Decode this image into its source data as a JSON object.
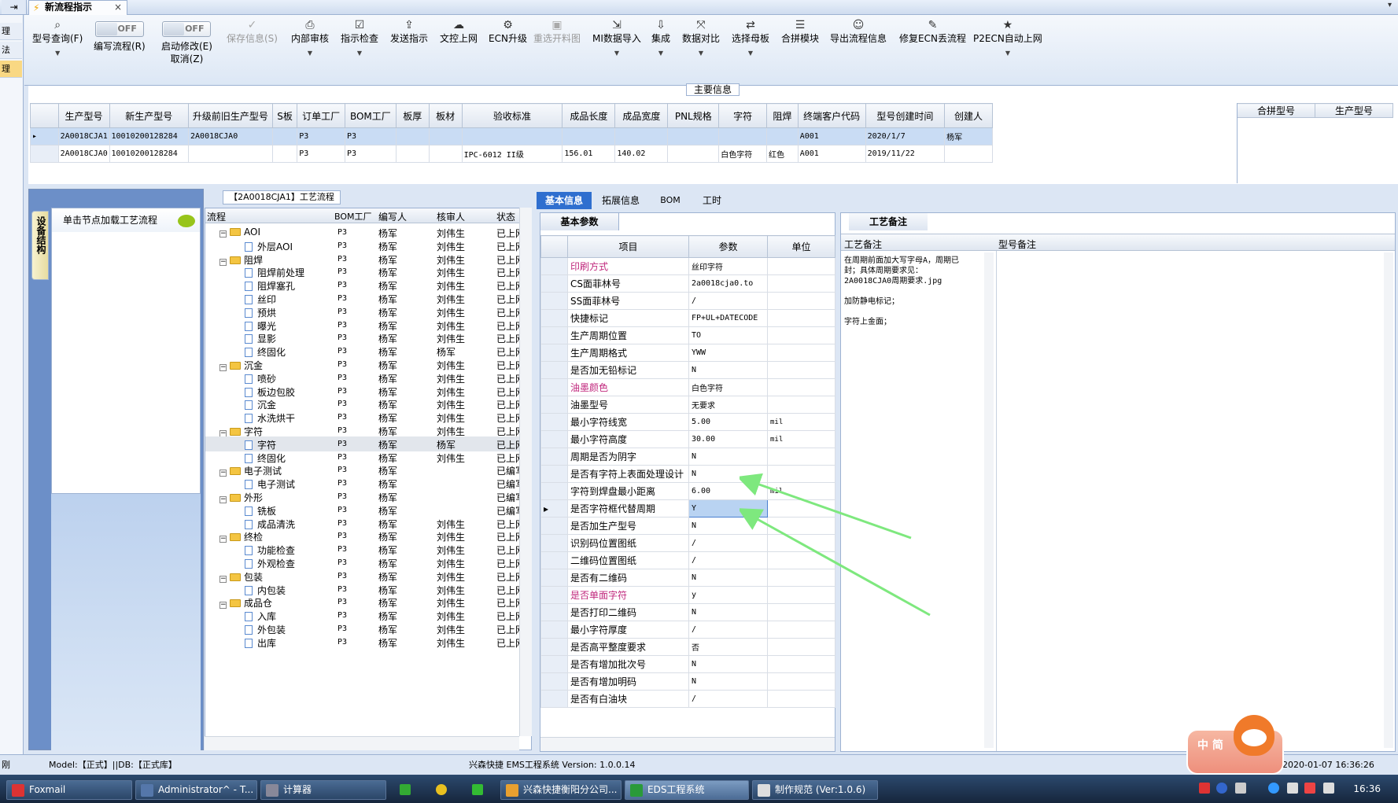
{
  "window": {
    "tab_title": "新流程指示",
    "close": "×"
  },
  "left_dock": {
    "items": [
      "理",
      "法",
      "理"
    ]
  },
  "ribbon": {
    "buttons": [
      {
        "label": "型号查询(F)",
        "icon": "search-icon",
        "has_dropdown": true
      },
      {
        "label": "编写流程(R)",
        "toggle": "OFF"
      },
      {
        "label": "启动修改(E)",
        "label2": "取消(Z)",
        "toggle": "OFF"
      },
      {
        "label": "保存信息(S)",
        "icon": "check-icon",
        "disabled": true
      },
      {
        "label": "内部审核",
        "icon": "print-icon",
        "has_dropdown": true
      },
      {
        "label": "指示检查",
        "icon": "checklist-icon",
        "has_dropdown": true
      },
      {
        "label": "发送指示",
        "icon": "upload-icon"
      },
      {
        "label": "文控上网",
        "icon": "cloud-upload-icon"
      },
      {
        "label": "ECN升级",
        "icon": "ecn-icon"
      },
      {
        "label": "重选开料图",
        "icon": "image-icon",
        "disabled": true
      },
      {
        "label": "MI数据导入",
        "icon": "import-icon",
        "has_dropdown": true
      },
      {
        "label": "集成",
        "icon": "download-icon",
        "has_dropdown": true
      },
      {
        "label": "数据对比",
        "icon": "compare-icon",
        "has_dropdown": true
      },
      {
        "label": "选择母板",
        "icon": "shuffle-icon",
        "has_dropdown": true
      },
      {
        "label": "合拼模块",
        "icon": "list-icon"
      },
      {
        "label": "导出流程信息",
        "icon": "smile-icon"
      },
      {
        "label": "修复ECN丢流程",
        "icon": "wrench-icon"
      },
      {
        "label": "P2ECN自动上网",
        "icon": "star-icon",
        "has_dropdown": true
      }
    ]
  },
  "main_info": {
    "legend": "主要信息",
    "columns": [
      "生产型号",
      "新生产型号",
      "升级前旧生产型号",
      "S板",
      "订单工厂",
      "BOM工厂",
      "板厚",
      "板材",
      "验收标准",
      "成品长度",
      "成品宽度",
      "PNL规格",
      "字符",
      "阻焊",
      "终端客户代码",
      "型号创建时间",
      "创建人"
    ],
    "rows": [
      [
        "2A0018CJA1",
        "10010200128284",
        "2A0018CJA0",
        "",
        "P3",
        "P3",
        "",
        "",
        "",
        "",
        "",
        "",
        "",
        "",
        "A001",
        "2020/1/7",
        "杨军"
      ],
      [
        "2A0018CJA0",
        "10010200128284",
        "",
        "",
        "P3",
        "P3",
        "",
        "",
        "IPC-6012 II级",
        "156.01",
        "140.02",
        "",
        "白色字符",
        "红色",
        "A001",
        "2019/11/22",
        ""
      ]
    ],
    "side_columns": [
      "合拼型号",
      "生产型号"
    ]
  },
  "left_panel": {
    "vertical_tab": "设备结构",
    "header": "单击节点加载工艺流程"
  },
  "flow": {
    "legend": "【2A0018CJA1】工艺流程",
    "columns": [
      "流程",
      "BOM工厂",
      "编写人",
      "核审人",
      "状态"
    ],
    "rows": [
      {
        "level": 1,
        "folder": true,
        "name": "AOI",
        "bom": "P3",
        "writer": "杨军",
        "reviewer": "刘伟生",
        "status": "已上网"
      },
      {
        "level": 2,
        "folder": false,
        "name": "外层AOI",
        "bom": "P3",
        "writer": "杨军",
        "reviewer": "刘伟生",
        "status": "已上网"
      },
      {
        "level": 1,
        "folder": true,
        "name": "阻焊",
        "bom": "P3",
        "writer": "杨军",
        "reviewer": "刘伟生",
        "status": "已上网"
      },
      {
        "level": 2,
        "folder": false,
        "name": "阻焊前处理",
        "bom": "P3",
        "writer": "杨军",
        "reviewer": "刘伟生",
        "status": "已上网"
      },
      {
        "level": 2,
        "folder": false,
        "name": "阻焊塞孔",
        "bom": "P3",
        "writer": "杨军",
        "reviewer": "刘伟生",
        "status": "已上网"
      },
      {
        "level": 2,
        "folder": false,
        "name": "丝印",
        "bom": "P3",
        "writer": "杨军",
        "reviewer": "刘伟生",
        "status": "已上网"
      },
      {
        "level": 2,
        "folder": false,
        "name": "预烘",
        "bom": "P3",
        "writer": "杨军",
        "reviewer": "刘伟生",
        "status": "已上网"
      },
      {
        "level": 2,
        "folder": false,
        "name": "曝光",
        "bom": "P3",
        "writer": "杨军",
        "reviewer": "刘伟生",
        "status": "已上网"
      },
      {
        "level": 2,
        "folder": false,
        "name": "显影",
        "bom": "P3",
        "writer": "杨军",
        "reviewer": "刘伟生",
        "status": "已上网"
      },
      {
        "level": 2,
        "folder": false,
        "name": "终固化",
        "bom": "P3",
        "writer": "杨军",
        "reviewer": "杨军",
        "status": "已上网"
      },
      {
        "level": 1,
        "folder": true,
        "name": "沉金",
        "bom": "P3",
        "writer": "杨军",
        "reviewer": "刘伟生",
        "status": "已上网"
      },
      {
        "level": 2,
        "folder": false,
        "name": "喷砂",
        "bom": "P3",
        "writer": "杨军",
        "reviewer": "刘伟生",
        "status": "已上网"
      },
      {
        "level": 2,
        "folder": false,
        "name": "板边包胶",
        "bom": "P3",
        "writer": "杨军",
        "reviewer": "刘伟生",
        "status": "已上网"
      },
      {
        "level": 2,
        "folder": false,
        "name": "沉金",
        "bom": "P3",
        "writer": "杨军",
        "reviewer": "刘伟生",
        "status": "已上网"
      },
      {
        "level": 2,
        "folder": false,
        "name": "水洗烘干",
        "bom": "P3",
        "writer": "杨军",
        "reviewer": "刘伟生",
        "status": "已上网"
      },
      {
        "level": 1,
        "folder": true,
        "name": "字符",
        "bom": "P3",
        "writer": "杨军",
        "reviewer": "刘伟生",
        "status": "已上网"
      },
      {
        "level": 2,
        "folder": false,
        "name": "字符",
        "bom": "P3",
        "writer": "杨军",
        "reviewer": "杨军",
        "status": "已上网",
        "highlight": true
      },
      {
        "level": 2,
        "folder": false,
        "name": "终固化",
        "bom": "P3",
        "writer": "杨军",
        "reviewer": "刘伟生",
        "status": "已上网"
      },
      {
        "level": 1,
        "folder": true,
        "name": "电子测试",
        "bom": "P3",
        "writer": "杨军",
        "reviewer": "",
        "status": "已编写"
      },
      {
        "level": 2,
        "folder": false,
        "name": "电子测试",
        "bom": "P3",
        "writer": "杨军",
        "reviewer": "",
        "status": "已编写"
      },
      {
        "level": 1,
        "folder": true,
        "name": "外形",
        "bom": "P3",
        "writer": "杨军",
        "reviewer": "",
        "status": "已编写"
      },
      {
        "level": 2,
        "folder": false,
        "name": "铣板",
        "bom": "P3",
        "writer": "杨军",
        "reviewer": "",
        "status": "已编写"
      },
      {
        "level": 2,
        "folder": false,
        "name": "成品清洗",
        "bom": "P3",
        "writer": "杨军",
        "reviewer": "刘伟生",
        "status": "已上网"
      },
      {
        "level": 1,
        "folder": true,
        "name": "终检",
        "bom": "P3",
        "writer": "杨军",
        "reviewer": "刘伟生",
        "status": "已上网"
      },
      {
        "level": 2,
        "folder": false,
        "name": "功能检查",
        "bom": "P3",
        "writer": "杨军",
        "reviewer": "刘伟生",
        "status": "已上网"
      },
      {
        "level": 2,
        "folder": false,
        "name": "外观检查",
        "bom": "P3",
        "writer": "杨军",
        "reviewer": "刘伟生",
        "status": "已上网"
      },
      {
        "level": 1,
        "folder": true,
        "name": "包装",
        "bom": "P3",
        "writer": "杨军",
        "reviewer": "刘伟生",
        "status": "已上网"
      },
      {
        "level": 2,
        "folder": false,
        "name": "内包装",
        "bom": "P3",
        "writer": "杨军",
        "reviewer": "刘伟生",
        "status": "已上网"
      },
      {
        "level": 1,
        "folder": true,
        "name": "成品仓",
        "bom": "P3",
        "writer": "杨军",
        "reviewer": "刘伟生",
        "status": "已上网"
      },
      {
        "level": 2,
        "folder": false,
        "name": "入库",
        "bom": "P3",
        "writer": "杨军",
        "reviewer": "刘伟生",
        "status": "已上网"
      },
      {
        "level": 2,
        "folder": false,
        "name": "外包装",
        "bom": "P3",
        "writer": "杨军",
        "reviewer": "刘伟生",
        "status": "已上网"
      },
      {
        "level": 2,
        "folder": false,
        "name": "出库",
        "bom": "P3",
        "writer": "杨军",
        "reviewer": "刘伟生",
        "status": "已上网"
      }
    ]
  },
  "detail_tabs": [
    "基本信息",
    "拓展信息",
    "BOM",
    "工时"
  ],
  "params": {
    "tab": "基本参数",
    "columns": [
      "项目",
      "参数",
      "单位"
    ],
    "rows": [
      {
        "item": "印刷方式",
        "value": "丝印字符",
        "unit": "",
        "pink": true
      },
      {
        "item": "CS面菲林号",
        "value": "2a0018cja0.to",
        "unit": ""
      },
      {
        "item": "SS面菲林号",
        "value": "/",
        "unit": ""
      },
      {
        "item": "快捷标记",
        "value": "FP+UL+DATECODE",
        "unit": ""
      },
      {
        "item": "生产周期位置",
        "value": "TO",
        "unit": ""
      },
      {
        "item": "生产周期格式",
        "value": "YWW",
        "unit": ""
      },
      {
        "item": "是否加无铅标记",
        "value": "N",
        "unit": ""
      },
      {
        "item": "油墨颜色",
        "value": "白色字符",
        "unit": "",
        "pink": true
      },
      {
        "item": "油墨型号",
        "value": "无要求",
        "unit": ""
      },
      {
        "item": "最小字符线宽",
        "value": "5.00",
        "unit": "mil"
      },
      {
        "item": "最小字符高度",
        "value": "30.00",
        "unit": "mil"
      },
      {
        "item": "周期是否为阴字",
        "value": "N",
        "unit": ""
      },
      {
        "item": "是否有字符上表面处理设计",
        "value": "N",
        "unit": ""
      },
      {
        "item": "字符到焊盘最小距离",
        "value": "6.00",
        "unit": "mil"
      },
      {
        "item": "是否字符框代替周期",
        "value": "Y",
        "unit": "",
        "selected": true
      },
      {
        "item": "是否加生产型号",
        "value": "N",
        "unit": ""
      },
      {
        "item": "识别码位置图纸",
        "value": "/",
        "unit": ""
      },
      {
        "item": "二维码位置图纸",
        "value": "/",
        "unit": ""
      },
      {
        "item": "是否有二维码",
        "value": "N",
        "unit": ""
      },
      {
        "item": "是否单面字符",
        "value": "y",
        "unit": "",
        "pink": true
      },
      {
        "item": "是否打印二维码",
        "value": "N",
        "unit": ""
      },
      {
        "item": "最小字符厚度",
        "value": "/",
        "unit": ""
      },
      {
        "item": "是否高平整度要求",
        "value": "否",
        "unit": ""
      },
      {
        "item": "是否有增加批次号",
        "value": "N",
        "unit": ""
      },
      {
        "item": "是否有增加明码",
        "value": "N",
        "unit": ""
      },
      {
        "item": "是否有白油块",
        "value": "/",
        "unit": ""
      }
    ]
  },
  "notes": {
    "tab": "工艺备注",
    "col1": "工艺备注",
    "col2": "型号备注",
    "text": "在周期前面加大写字母A，周期已\n封；具体周期要求见：\n2A0018CJA0周期要求.jpg\n\n加防静电标记；\n\n字符上金面；"
  },
  "status": {
    "left": "刚",
    "model": "Model:【正式】||DB:【正式库】",
    "center": "兴森快捷 EMS工程系统 Version: 1.0.0.14",
    "datetime": "2020-01-07 16:36:26"
  },
  "ime": {
    "label": "中 简"
  },
  "taskbar": {
    "items": [
      {
        "label": "Foxmail",
        "color": "#d33"
      },
      {
        "label": "Administrator^ - T...",
        "color": "#5577aa"
      },
      {
        "label": "计算器",
        "color": "#889"
      },
      {
        "label": "兴森快捷衡阳分公司...",
        "color": "#e8a030"
      },
      {
        "label": "EDS工程系统",
        "color": "#2a9a3a",
        "active": true
      },
      {
        "label": "制作规范 (Ver:1.0.6)",
        "color": "#ddd"
      }
    ],
    "clock": "16:36"
  },
  "colors": {
    "accent": "#2f6fcf",
    "pink": "#c0287d",
    "arrow": "#7ee87e"
  }
}
